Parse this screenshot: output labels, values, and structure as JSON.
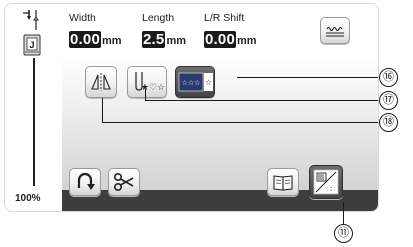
{
  "stitch_settings": {
    "width": {
      "label": "Width",
      "value": "0.00",
      "unit": "mm"
    },
    "length": {
      "label": "Length",
      "value": "2.5",
      "unit": "mm"
    },
    "lr_shift": {
      "label": "L/R Shift",
      "value": "0.00",
      "unit": "mm"
    }
  },
  "zoom_level": "100%",
  "presser_foot_letter": "J",
  "callouts": {
    "c16": "⑯",
    "c17": "⑰",
    "c18": "⑱",
    "c11": "⑪"
  },
  "icons": {
    "stitch_preview": "wavy-line-icon",
    "mirror": "mirror-image-icon",
    "needle_position_star": "needle-star-icon",
    "pattern_star": "pattern-star-icon",
    "back_tack": "reverse-stitch-icon",
    "thread_cut": "scissors-icon",
    "manual": "book-icon",
    "settings_grid": "stitch-settings-icon"
  },
  "colors": {
    "value_bg": "#1a1a1a",
    "bottom_bar": "#3d3d3d"
  }
}
